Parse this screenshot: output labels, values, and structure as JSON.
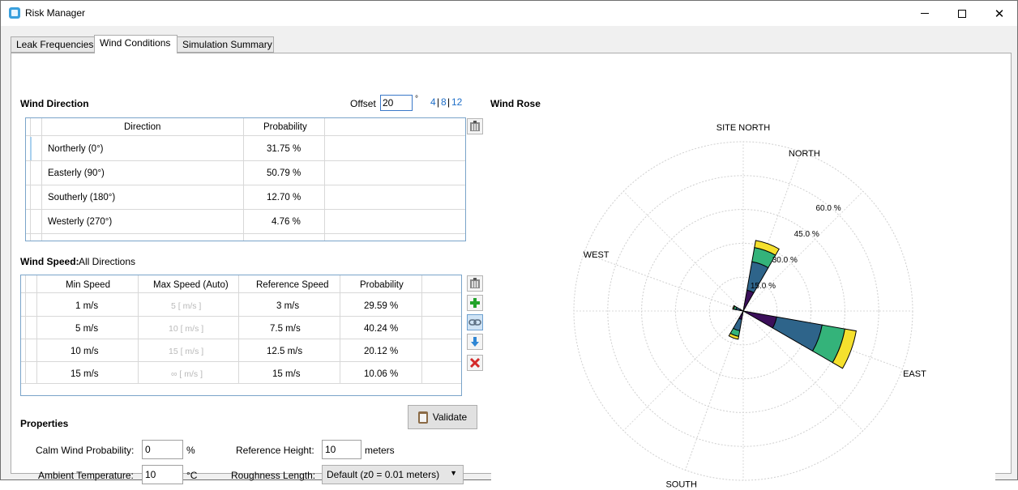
{
  "window": {
    "title": "Risk Manager"
  },
  "tabs": [
    "Leak Frequencies",
    "Wind Conditions",
    "Simulation Summary"
  ],
  "wind_direction": {
    "title": "Wind Direction",
    "offset_label": "Offset",
    "offset_value": "20",
    "offset_unit": "°",
    "presets": [
      "4",
      "8",
      "12"
    ],
    "preset_sep": "|",
    "columns": [
      "Direction",
      "Probability"
    ],
    "rows": [
      {
        "direction": "Northerly (0°)",
        "probability": "31.75  %"
      },
      {
        "direction": "Easterly (90°)",
        "probability": "50.79  %"
      },
      {
        "direction": "Southerly (180°)",
        "probability": "12.70  %"
      },
      {
        "direction": "Westerly (270°)",
        "probability": "4.76  %"
      }
    ]
  },
  "wind_speed": {
    "title": "Wind Speed:",
    "subtitle": "All Directions",
    "columns": [
      "Min Speed",
      "Max Speed (Auto)",
      "Reference Speed",
      "Probability"
    ],
    "rows": [
      {
        "min": "1  m/s",
        "max": "5 [ m/s ]",
        "ref": "3  m/s",
        "prob": "29.59  %"
      },
      {
        "min": "5  m/s",
        "max": "10 [ m/s ]",
        "ref": "7.5  m/s",
        "prob": "40.24  %"
      },
      {
        "min": "10  m/s",
        "max": "15 [ m/s ]",
        "ref": "12.5  m/s",
        "prob": "20.12  %"
      },
      {
        "min": "15  m/s",
        "max": "∞ [ m/s ]",
        "ref": "15  m/s",
        "prob": "10.06  %"
      }
    ]
  },
  "properties": {
    "title": "Properties",
    "validate_label": "Validate",
    "calm_label": "Calm Wind Probability:",
    "calm_value": "0",
    "calm_unit": "%",
    "ambient_label": "Ambient Temperature:",
    "ambient_value": "10",
    "ambient_unit": "°C",
    "ref_height_label": "Reference Height:",
    "ref_height_value": "10",
    "ref_height_unit": "meters",
    "roughness_label": "Roughness Length:",
    "roughness_value": "Default (z0 = 0.01 meters)"
  },
  "wind_rose": {
    "title": "Wind Rose",
    "compass": {
      "site_north": "SITE NORTH",
      "north": "NORTH",
      "east": "EAST",
      "south": "SOUTH",
      "west": "WEST"
    },
    "ring_labels": [
      "15.0 %",
      "30.0 %",
      "45.0 %",
      "60.0 %"
    ],
    "ring_values": [
      15,
      30,
      45,
      60
    ],
    "max_value": 75,
    "rotation_deg": 20,
    "speed_colors": [
      "#3b0f5a",
      "#2e648a",
      "#34b37a",
      "#f5e02d"
    ],
    "petals": [
      {
        "direction_deg": 0,
        "segments": [
          9.39,
          12.78,
          6.39,
          3.19
        ]
      },
      {
        "direction_deg": 90,
        "segments": [
          15.03,
          20.44,
          10.22,
          5.1
        ]
      },
      {
        "direction_deg": 180,
        "segments": [
          3.76,
          5.11,
          2.55,
          1.28
        ]
      },
      {
        "direction_deg": 270,
        "segments": [
          1.41,
          1.91,
          0.96,
          0.48
        ]
      }
    ]
  }
}
